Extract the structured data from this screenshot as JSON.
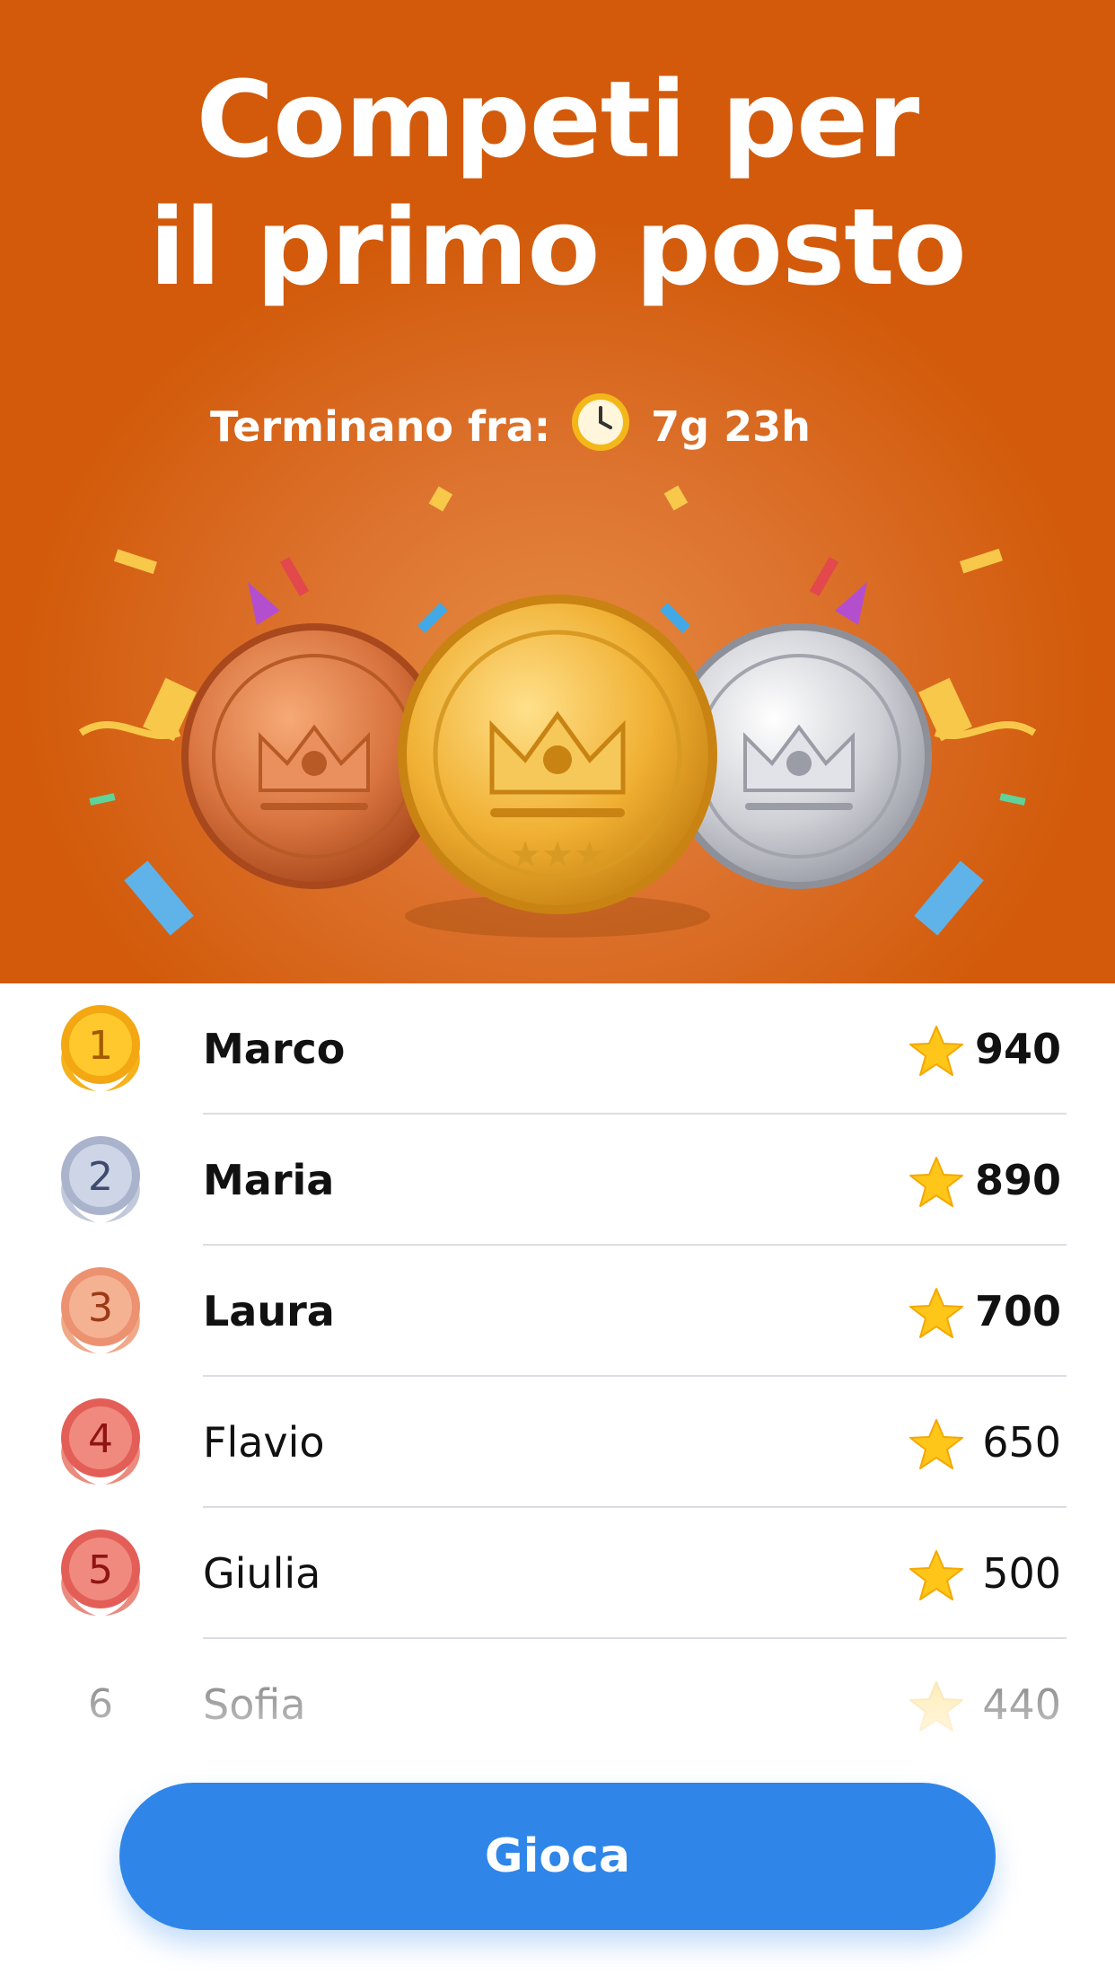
{
  "hero": {
    "title_line1": "Competi per",
    "title_line2": "il primo posto",
    "timer_label": "Terminano fra:",
    "timer_value": "7g 23h",
    "accent": "#d25a0a"
  },
  "leaderboard": [
    {
      "rank": "1",
      "name": "Marco",
      "score": "940",
      "badge": "gold"
    },
    {
      "rank": "2",
      "name": "Maria",
      "score": "890",
      "badge": "silver"
    },
    {
      "rank": "3",
      "name": "Laura",
      "score": "700",
      "badge": "bronze"
    },
    {
      "rank": "4",
      "name": "Flavio",
      "score": "650",
      "badge": "red"
    },
    {
      "rank": "5",
      "name": "Giulia",
      "score": "500",
      "badge": "red"
    },
    {
      "rank": "6",
      "name": "Sofia",
      "score": "440",
      "badge": "none"
    }
  ],
  "play_button": {
    "label": "Gioca",
    "color": "#2f86e8"
  },
  "icons": {
    "clock": "clock-icon",
    "star": "star-icon",
    "medal": "medal-icon"
  }
}
